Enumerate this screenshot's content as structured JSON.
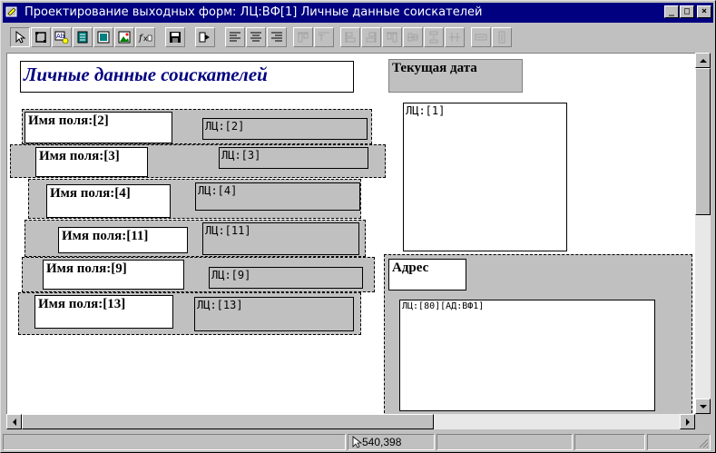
{
  "window": {
    "title": "Проектирование выходных форм: ЛЦ:ВФ[1] Личные данные соискателей",
    "minimize": "_",
    "maximize": "□",
    "close": "×"
  },
  "toolbar": {
    "tools": [
      "select-arrow",
      "frame",
      "label-tool",
      "data-field",
      "group-tool",
      "image-tool",
      "formula-tool",
      "save",
      "run",
      "align-left",
      "align-center",
      "align-right",
      "align-top",
      "align-baseline",
      "distribute-left",
      "distribute-right",
      "distribute-top",
      "distribute-middle",
      "space-vertical",
      "space-even",
      "same-width",
      "same-height"
    ]
  },
  "form": {
    "title": "Личные данные соискателей",
    "current_date_label": "Текущая дата",
    "photo_field": "ЛЦ:[1]",
    "rows": [
      {
        "label": "Имя поля:[2]",
        "field": "ЛЦ:[2]"
      },
      {
        "label": "Имя поля:[3]",
        "field": "ЛЦ:[3]"
      },
      {
        "label": "Имя поля:[4]",
        "field": "ЛЦ:[4]"
      },
      {
        "label": "Имя поля:[11]",
        "field": "ЛЦ:[11]"
      },
      {
        "label": "Имя поля:[9]",
        "field": "ЛЦ:[9]"
      },
      {
        "label": "Имя поля:[13]",
        "field": "ЛЦ:[13]"
      }
    ],
    "address_label": "Адрес",
    "address_field": "ЛЦ:[80][АД:ВФ1]"
  },
  "status": {
    "coords": "540,398"
  },
  "colors": {
    "title_color": "#000080",
    "titlebar_bg": "#000080",
    "group_bg": "#c0c0c0"
  }
}
